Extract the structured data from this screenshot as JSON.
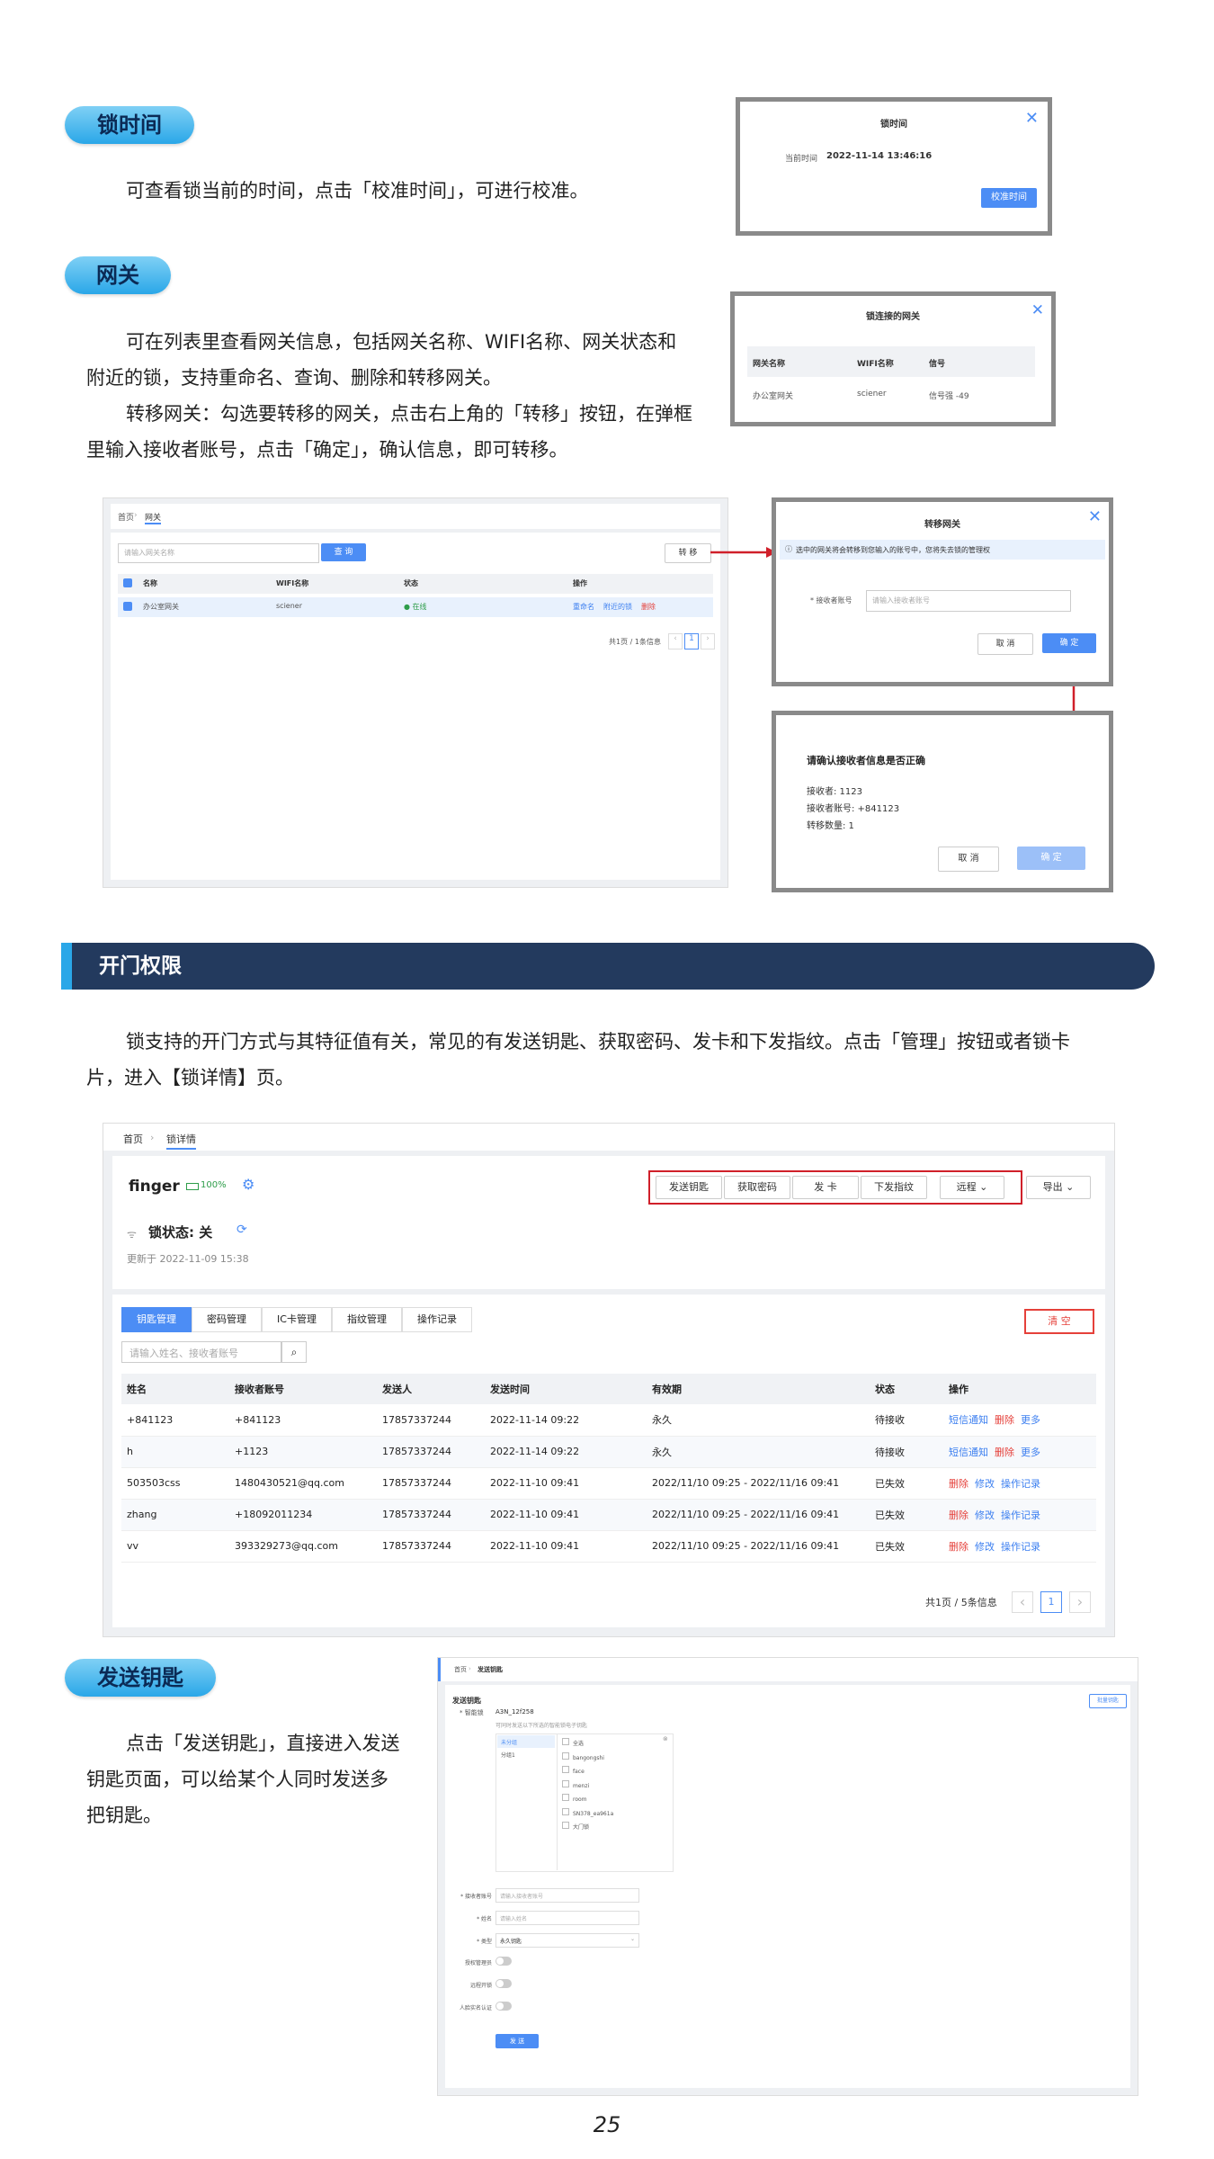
{
  "section_lock_time": {
    "pill": "锁时间",
    "text": "可查看锁当前的时间，点击「校准时间」，可进行校准。",
    "dialog": {
      "title": "锁时间",
      "label": "当前时间",
      "value": "2022-11-14 13:46:16",
      "button": "校准时间"
    }
  },
  "section_gateway": {
    "pill": "网关",
    "p1a": "可在列表里查看网关信息，包括网关名称、WIFI名称、网关状态和",
    "p1b": "附近的锁，支持重命名、查询、删除和转移网关。",
    "p2a": "转移网关：勾选要转移的网关，点击右上角的「转移」按钮，在弹框",
    "p2b": "里输入接收者账号，点击「确定」，确认信息，即可转移。",
    "linked_dialog": {
      "title": "锁连接的网关",
      "headers": [
        "网关名称",
        "WIFI名称",
        "信号"
      ],
      "row": [
        "办公室网关",
        "sciener",
        "信号强 -49"
      ]
    },
    "list": {
      "breadcrumb": [
        "首页",
        "网关"
      ],
      "search_placeholder": "请输入网关名称",
      "search_btn": "查 询",
      "transfer_btn": "转 移",
      "headers": [
        "名称",
        "WIFI名称",
        "状态",
        "操作"
      ],
      "row": {
        "name": "办公室网关",
        "wifi": "sciener",
        "status": "● 在线",
        "op1": "重命名",
        "op2": "附近的锁",
        "op3": "删除"
      },
      "pager": "共1页 / 1条信息",
      "page": "1"
    },
    "transfer_dialog": {
      "title": "转移网关",
      "notice": "选中的网关将会转移到您输入的账号中，您将失去锁的管理权",
      "label": "* 接收者账号",
      "placeholder": "请输入接收者账号",
      "cancel": "取 消",
      "ok": "确 定"
    },
    "confirm_dialog": {
      "title": "请确认接收者信息是否正确",
      "l1": "接收者: 1123",
      "l2": "接收者账号: +841123",
      "l3": "转移数量: 1",
      "cancel": "取 消",
      "ok": "确 定"
    }
  },
  "section_open": {
    "header": "开门权限",
    "p1": "锁支持的开门方式与其特征值有关，常见的有发送钥匙、获取密码、发卡和下发指纹。点击「管理」按钮或者锁卡",
    "p2": "片，进入【锁详情】页。",
    "detail": {
      "breadcrumb": [
        "首页",
        "锁详情"
      ],
      "lock_name": "finger",
      "battery": "100%",
      "actions": [
        "发送钥匙",
        "获取密码",
        "发 卡",
        "下发指纹",
        "远程",
        "导出"
      ],
      "status": "锁状态: 关",
      "updated": "更新于 2022-11-09 15:38",
      "tabs": [
        "钥匙管理",
        "密码管理",
        "IC卡管理",
        "指纹管理",
        "操作记录"
      ],
      "clear": "清 空",
      "search_placeholder": "请输入姓名、接收者账号",
      "headers": [
        "姓名",
        "接收者账号",
        "发送人",
        "发送时间",
        "有效期",
        "状态",
        "操作"
      ],
      "rows": [
        {
          "name": "+841123",
          "acct": "+841123",
          "sender": "17857337244",
          "time": "2022-11-14 09:22",
          "valid": "永久",
          "state": "待接收",
          "ops": [
            "短信通知",
            "删除",
            "更多"
          ]
        },
        {
          "name": "h",
          "acct": "+1123",
          "sender": "17857337244",
          "time": "2022-11-14 09:22",
          "valid": "永久",
          "state": "待接收",
          "ops": [
            "短信通知",
            "删除",
            "更多"
          ]
        },
        {
          "name": "503503css",
          "acct": "1480430521@qq.com",
          "sender": "17857337244",
          "time": "2022-11-10 09:41",
          "valid": "2022/11/10 09:25 - 2022/11/16 09:41",
          "state": "已失效",
          "ops": [
            "删除",
            "修改",
            "操作记录"
          ]
        },
        {
          "name": "zhang",
          "acct": "+18092011234",
          "sender": "17857337244",
          "time": "2022-11-10 09:41",
          "valid": "2022/11/10 09:25 - 2022/11/16 09:41",
          "state": "已失效",
          "ops": [
            "删除",
            "修改",
            "操作记录"
          ]
        },
        {
          "name": "vv",
          "acct": "393329273@qq.com",
          "sender": "17857337244",
          "time": "2022-11-10 09:41",
          "valid": "2022/11/10 09:25 - 2022/11/16 09:41",
          "state": "已失效",
          "ops": [
            "删除",
            "修改",
            "操作记录"
          ]
        }
      ],
      "pager": "共1页 / 5条信息",
      "page": "1"
    }
  },
  "section_send_key": {
    "pill": "发送钥匙",
    "p1": "点击「发送钥匙」，直接进入发送",
    "p2": "钥匙页面，可以给某个人同时发送多",
    "p3": "把钥匙。",
    "form": {
      "breadcrumb": [
        "首页",
        "发送钥匙"
      ],
      "title": "发送钥匙",
      "top_btn": "批量钥匙",
      "lock_label": "* 智能锁",
      "lock_value": "A3N_12f258",
      "hint": "可同时发送以下所选的智能锁电子钥匙",
      "groups": [
        "未分组",
        "分组1"
      ],
      "locks": [
        "全选",
        "bangongshi",
        "face",
        "menzi",
        "room",
        "SN378_ea961a",
        "大门锁"
      ],
      "fields": [
        {
          "label": "* 接收者账号",
          "placeholder": "请输入接收者账号"
        },
        {
          "label": "* 姓名",
          "placeholder": "请输入姓名"
        },
        {
          "label": "* 类型",
          "placeholder": "永久钥匙"
        }
      ],
      "toggles": [
        "授权管理员",
        "远程开锁",
        "人脸实名认证"
      ],
      "submit": "发 送"
    }
  },
  "page_number": "25"
}
